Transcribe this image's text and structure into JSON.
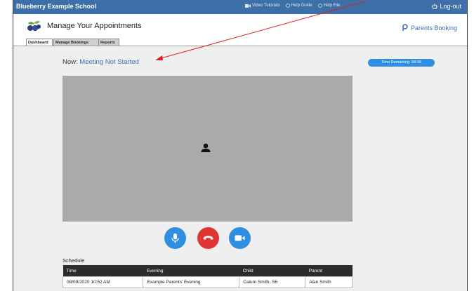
{
  "topbar": {
    "school": "Blueberry Example School",
    "links": [
      "Video Tutorials",
      "Help Guide",
      "Help File"
    ],
    "logout": "Log-out"
  },
  "header": {
    "title": "Manage Your Appointments",
    "brand": "Parents Booking"
  },
  "tabs": [
    "Dashboard",
    "Manage Bookings",
    "Reports"
  ],
  "status": {
    "label": "Now: ",
    "value": "Meeting Not Started"
  },
  "timer": "Time Remaining: 00:00",
  "icons": {
    "mic": "microphone-icon",
    "hangup": "phone-hangup-icon",
    "camera": "video-camera-icon",
    "person": "person-placeholder-icon"
  },
  "colors": {
    "topbar": "#3d6fa8",
    "blue_button": "#2f8ee0",
    "red_button": "#e03535",
    "video_bg": "#aaaaaa",
    "annotation": "#e02020"
  },
  "schedule": {
    "title": "Schedule",
    "columns": [
      "Time",
      "Evening",
      "Child",
      "Parent"
    ],
    "rows": [
      [
        "08/09/2020 10:52 AM",
        "Example Parents' Evening",
        "Calum Smith, S6",
        "Alan Smith"
      ]
    ]
  }
}
